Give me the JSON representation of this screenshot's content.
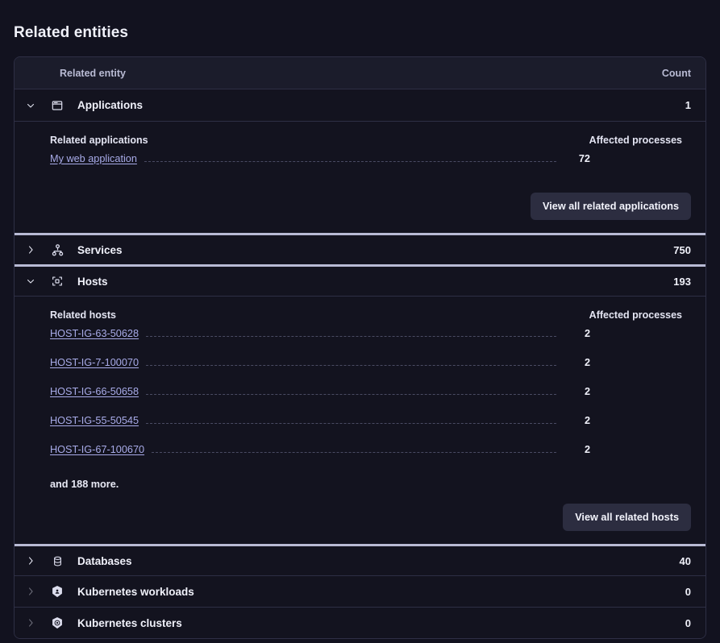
{
  "page": {
    "title": "Related entities"
  },
  "table": {
    "columns": {
      "entity": "Related entity",
      "count": "Count"
    },
    "groups": [
      {
        "id": "applications",
        "label": "Applications",
        "icon": "application-window-icon",
        "count": "1",
        "expanded": true,
        "chevron": "chevron-down-icon",
        "panel": {
          "header_left": "Related applications",
          "header_right": "Affected processes",
          "rows": [
            {
              "name": "My web application",
              "value": "72"
            }
          ],
          "more": "",
          "button": "View all related applications"
        }
      },
      {
        "id": "services",
        "label": "Services",
        "icon": "services-hierarchy-icon",
        "count": "750",
        "expanded": false,
        "chevron": "chevron-right-icon"
      },
      {
        "id": "hosts",
        "label": "Hosts",
        "icon": "host-bracket-icon",
        "count": "193",
        "expanded": true,
        "chevron": "chevron-down-icon",
        "panel": {
          "header_left": "Related hosts",
          "header_right": "Affected processes",
          "rows": [
            {
              "name": "HOST-IG-63-50628",
              "value": "2"
            },
            {
              "name": "HOST-IG-7-100070",
              "value": "2"
            },
            {
              "name": "HOST-IG-66-50658",
              "value": "2"
            },
            {
              "name": "HOST-IG-55-50545",
              "value": "2"
            },
            {
              "name": "HOST-IG-67-100670",
              "value": "2"
            }
          ],
          "more": "and 188 more.",
          "button": "View all related hosts"
        }
      },
      {
        "id": "databases",
        "label": "Databases",
        "icon": "database-cylinder-icon",
        "count": "40",
        "expanded": false,
        "chevron": "chevron-right-icon"
      },
      {
        "id": "kubernetes-workloads",
        "label": "Kubernetes workloads",
        "icon": "kubernetes-workload-icon",
        "count": "0",
        "expanded": false,
        "chevron": "chevron-right-icon"
      },
      {
        "id": "kubernetes-clusters",
        "label": "Kubernetes clusters",
        "icon": "kubernetes-cluster-icon",
        "count": "0",
        "expanded": false,
        "chevron": "chevron-right-icon"
      }
    ]
  },
  "colors": {
    "background": "#12121f",
    "card": "#13131f",
    "header_row": "#1b1c2b",
    "border": "#2e2f45",
    "accent_separator": "#b8bad4",
    "link": "#a8abe8",
    "text": "#f0f1fa",
    "button": "#2c2d40"
  }
}
